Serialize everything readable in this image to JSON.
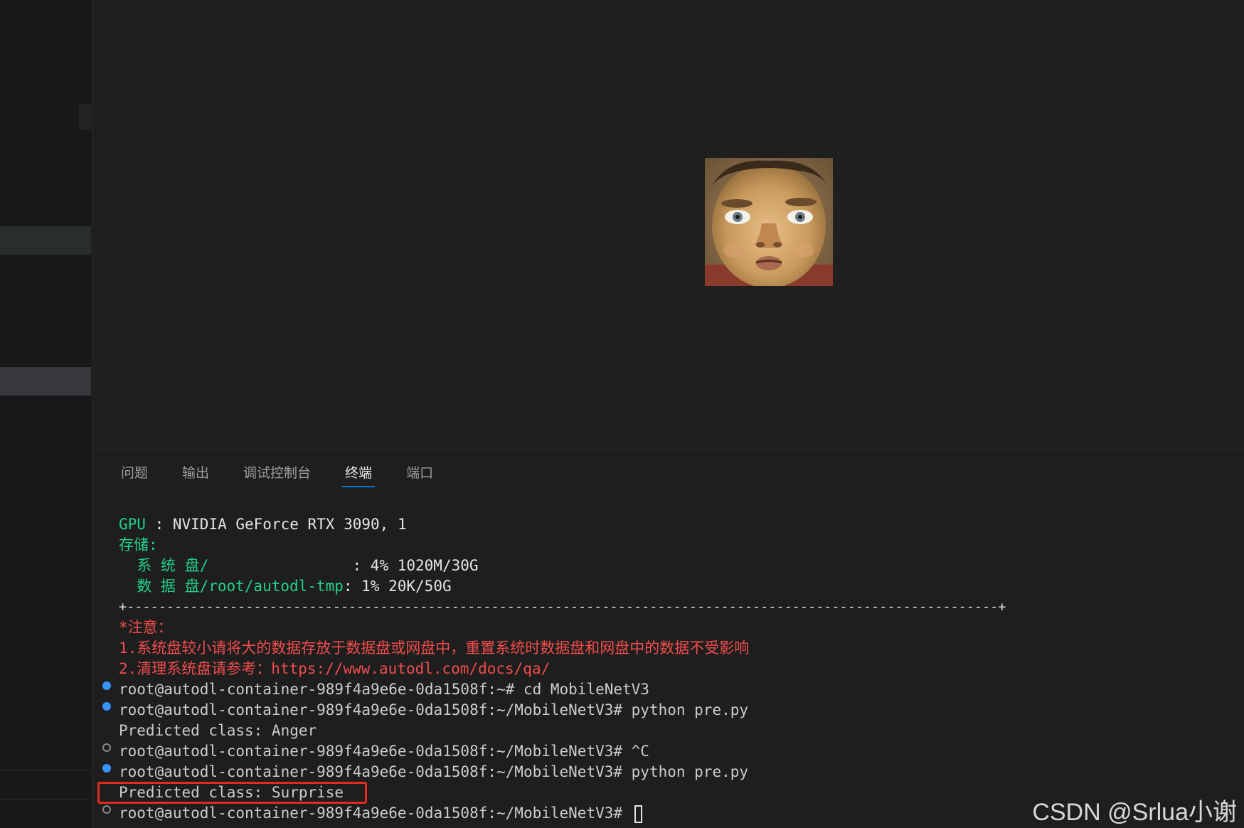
{
  "panel": {
    "tabs": [
      {
        "label": "问题"
      },
      {
        "label": "输出"
      },
      {
        "label": "调试控制台"
      },
      {
        "label": "终端"
      },
      {
        "label": "端口"
      }
    ]
  },
  "terminal": {
    "gpu_label": "GPU",
    "gpu_sep": " : ",
    "gpu_value": "NVIDIA GeForce RTX 3090, 1",
    "storage_label": "存储:",
    "sys_disk_label": "  系 统 盘/",
    "sys_disk_sep": "                : ",
    "sys_disk_value": "4% 1020M/30G",
    "data_disk_label": "  数 据 盘/root/autodl-tmp",
    "data_disk_sep": ": ",
    "data_disk_value": "1% 20K/50G",
    "separator": "+--------------------------------------------------------------------------------------------------------------+",
    "note_title": "*注意：",
    "note_1": "1.系统盘较小请将大的数据存放于数据盘或网盘中，重置系统时数据盘和网盘中的数据不受影响",
    "note_2_prefix": "2.清理系统盘请参考：",
    "note_2_link": "https://www.autodl.com/docs/qa/",
    "cmd_1": "root@autodl-container-989f4a9e6e-0da1508f:~# cd MobileNetV3",
    "cmd_2": "root@autodl-container-989f4a9e6e-0da1508f:~/MobileNetV3# python pre.py",
    "out_1": "Predicted class: Anger",
    "cmd_3": "root@autodl-container-989f4a9e6e-0da1508f:~/MobileNetV3# ^C",
    "cmd_4": "root@autodl-container-989f4a9e6e-0da1508f:~/MobileNetV3# python pre.py",
    "out_2": "Predicted class: Surprise",
    "prompt": "root@autodl-container-989f4a9e6e-0da1508f:~/MobileNetV3# "
  },
  "watermark": "CSDN @Srlua小谢",
  "colors": {
    "accent": "#0078d4",
    "green": "#23d18b",
    "red": "#f14c4c",
    "highlight": "#e6291f",
    "dot_blue": "#3794ff"
  }
}
